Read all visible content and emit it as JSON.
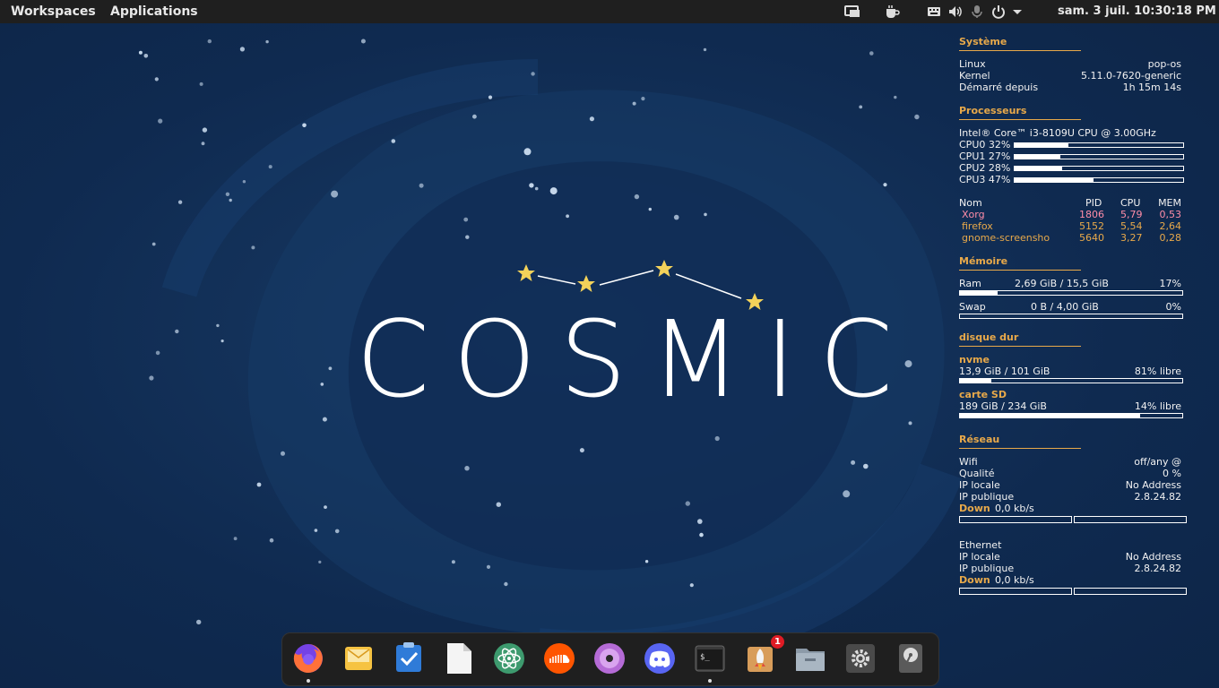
{
  "topbar": {
    "workspaces": "Workspaces",
    "applications": "Applications",
    "clock": "sam. 3 juil.  10:30:18 PM",
    "tray_icons": [
      "screen-share-icon",
      "coffee-icon",
      "keyboard-icon",
      "volume-icon",
      "microphone-icon",
      "power-icon",
      "chevron-down-icon"
    ]
  },
  "desktop": {
    "logo_text": "COSMIC"
  },
  "conky": {
    "system": {
      "title": "Système",
      "rows": [
        {
          "label": "Linux",
          "value": "pop-os"
        },
        {
          "label": "Kernel",
          "value": "5.11.0-7620-generic"
        },
        {
          "label": "Démarré depuis",
          "value": "1h 15m 14s"
        }
      ]
    },
    "cpu": {
      "title": "Processeurs",
      "model": "Intel® Core™ i3-8109U CPU @ 3.00GHz",
      "cores": [
        {
          "label": "CPU0 32%",
          "usage": 0.32
        },
        {
          "label": "CPU1 27%",
          "usage": 0.27
        },
        {
          "label": "CPU2 28%",
          "usage": 0.28
        },
        {
          "label": "CPU3 47%",
          "usage": 0.47
        }
      ],
      "proc_headers": {
        "name": "Nom",
        "pid": "PID",
        "cpu": "CPU",
        "mem": "MEM"
      },
      "processes": [
        {
          "name": "Xorg",
          "pid": "1806",
          "cpu": "5,79",
          "mem": "0,53"
        },
        {
          "name": "firefox",
          "pid": "5152",
          "cpu": "5,54",
          "mem": "2,64"
        },
        {
          "name": "gnome-screensho",
          "pid": "5640",
          "cpu": "3,27",
          "mem": "0,28"
        }
      ]
    },
    "memory": {
      "title": "Mémoire",
      "ram_label": "Ram",
      "ram_value": "2,69 GiB / 15,5 GiB",
      "ram_pct": "17%",
      "ram_usage": 0.17,
      "swap_label": "Swap",
      "swap_value": "0 B / 4,00 GiB",
      "swap_pct": "0%",
      "swap_usage": 0
    },
    "disk": {
      "title": "disque dur",
      "nvme_label": "nvme",
      "nvme_value": "13,9 GiB / 101 GiB",
      "nvme_free": "81% libre",
      "nvme_usage": 0.14,
      "sd_label": "carte SD",
      "sd_value": "189 GiB / 234 GiB",
      "sd_free": "14% libre",
      "sd_usage": 0.81
    },
    "network": {
      "title": "Réseau",
      "wifi_rows": [
        {
          "label": "Wifi",
          "value": "off/any @"
        },
        {
          "label": "Qualité",
          "value": "0 %"
        },
        {
          "label": "IP locale",
          "value": "No Address"
        },
        {
          "label": "IP publique",
          "value": "2.8.24.82"
        }
      ],
      "wifi_down_label": "Down",
      "wifi_down_value": "0,0 kb/s",
      "eth_label": "Ethernet",
      "eth_rows": [
        {
          "label": "IP locale",
          "value": "No Address"
        },
        {
          "label": "IP publique",
          "value": "2.8.24.82"
        }
      ],
      "eth_down_label": "Down",
      "eth_down_value": "0,0 kb/s"
    }
  },
  "dock": {
    "items": [
      {
        "name": "firefox-icon",
        "running": true
      },
      {
        "name": "mail-icon",
        "running": false
      },
      {
        "name": "tasks-icon",
        "running": false
      },
      {
        "name": "document-icon",
        "running": false
      },
      {
        "name": "atom-icon",
        "running": false
      },
      {
        "name": "soundcloud-icon",
        "running": false
      },
      {
        "name": "music-player-icon",
        "running": false
      },
      {
        "name": "discord-icon",
        "running": false
      },
      {
        "name": "terminal-icon",
        "running": true
      },
      {
        "name": "launcher-icon",
        "running": false,
        "badge": "1"
      },
      {
        "name": "file-manager-icon",
        "running": false
      },
      {
        "name": "settings-icon",
        "running": false
      },
      {
        "name": "disk-utility-icon",
        "running": false
      }
    ]
  },
  "colors": {
    "background": "#102b52",
    "accent": "#e8a94a",
    "process_text": "#ff8da8",
    "panel": "#1f1f1f"
  }
}
